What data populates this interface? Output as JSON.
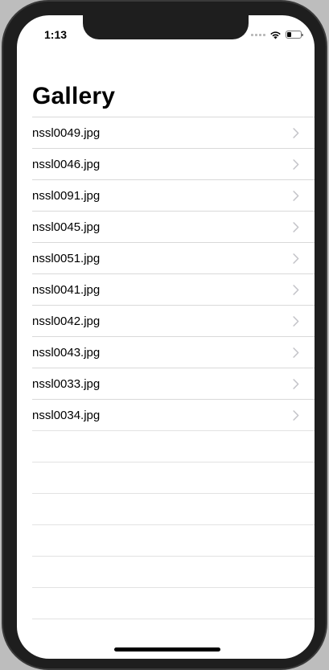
{
  "status_bar": {
    "time": "1:13"
  },
  "nav": {
    "title": "Gallery"
  },
  "gallery": {
    "items": [
      {
        "name": "nssl0049.jpg"
      },
      {
        "name": "nssl0046.jpg"
      },
      {
        "name": "nssl0091.jpg"
      },
      {
        "name": "nssl0045.jpg"
      },
      {
        "name": "nssl0051.jpg"
      },
      {
        "name": "nssl0041.jpg"
      },
      {
        "name": "nssl0042.jpg"
      },
      {
        "name": "nssl0043.jpg"
      },
      {
        "name": "nssl0033.jpg"
      },
      {
        "name": "nssl0034.jpg"
      }
    ]
  },
  "icons": {
    "row_accessory": "chevron-right-icon",
    "wifi": "wifi-icon",
    "battery": "battery-icon",
    "signal": "cellular-signal-icon"
  },
  "colors": {
    "separator": "#d9d9d9",
    "chevron": "#c4c4c9",
    "background": "#ffffff"
  }
}
